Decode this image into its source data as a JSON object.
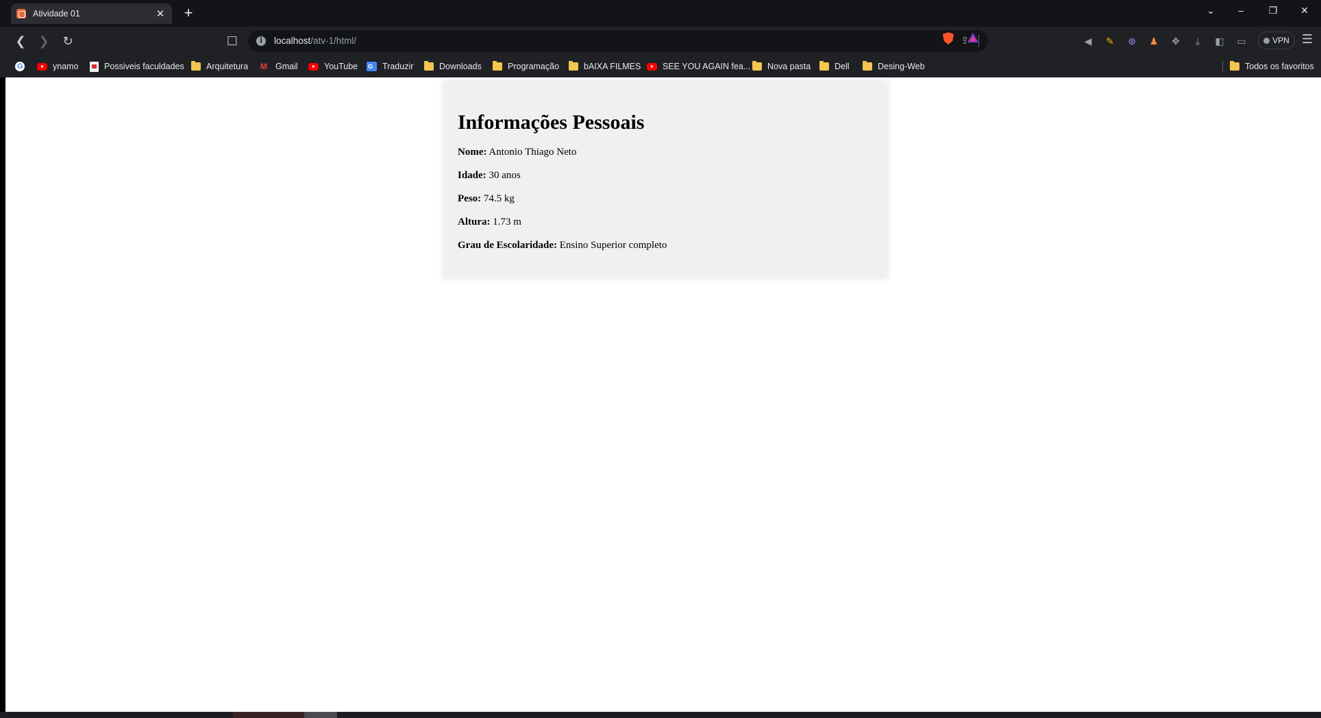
{
  "browser": {
    "tab": {
      "title": "Atividade 01",
      "favicon": "xampp-icon"
    },
    "address": {
      "host": "localhost",
      "path": "/atv-1/html/"
    },
    "vpn_label": "VPN",
    "bookmarks": [
      {
        "label": "",
        "icon": "google-icon"
      },
      {
        "label": "ynamo",
        "icon": "youtube-icon"
      },
      {
        "label": "Possiveis faculdades",
        "icon": "doc-icon"
      },
      {
        "label": "Arquitetura",
        "icon": "folder-icon"
      },
      {
        "label": "Gmail",
        "icon": "gmail-icon"
      },
      {
        "label": "YouTube",
        "icon": "youtube-icon"
      },
      {
        "label": "Traduzir",
        "icon": "translate-icon"
      },
      {
        "label": "Downloads",
        "icon": "folder-icon"
      },
      {
        "label": "Programação",
        "icon": "folder-icon"
      },
      {
        "label": "bAIXA FILMES",
        "icon": "folder-icon"
      },
      {
        "label": "SEE YOU AGAIN fea...",
        "icon": "youtube-icon"
      },
      {
        "label": "Nova pasta",
        "icon": "folder-icon"
      },
      {
        "label": "Dell",
        "icon": "folder-icon"
      },
      {
        "label": "Desing-Web",
        "icon": "folder-icon"
      },
      {
        "label": "Todos os favoritos",
        "icon": "folder-icon"
      }
    ]
  },
  "page": {
    "heading": "Informações Pessoais",
    "fields": [
      {
        "label": "Nome:",
        "value": "Antonio Thiago Neto"
      },
      {
        "label": "Idade:",
        "value": "30 anos"
      },
      {
        "label": "Peso:",
        "value": "74.5 kg"
      },
      {
        "label": "Altura:",
        "value": "1.73 m"
      },
      {
        "label": "Grau de Escolaridade:",
        "value": "Ensino Superior completo"
      }
    ]
  }
}
